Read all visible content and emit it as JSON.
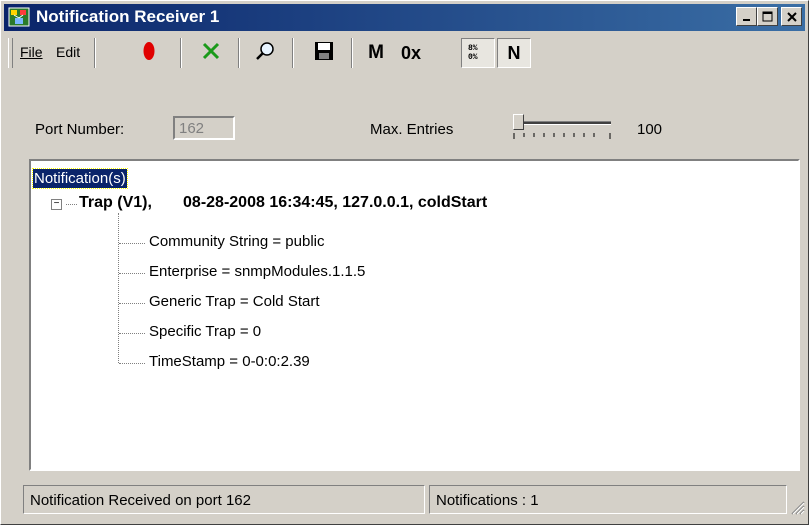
{
  "window": {
    "title": "Notification Receiver 1",
    "title_icon": "network-monitor-icon",
    "controls": {
      "minimize": "_",
      "maximize": "□",
      "close": "×"
    }
  },
  "menu": {
    "file": "File",
    "edit": "Edit"
  },
  "toolbar": {
    "record_icon": "record-icon",
    "delete_icon": "delete-icon",
    "find_icon": "find-icon",
    "save_icon": "save-icon",
    "m_label": "M",
    "hex_label": "0x",
    "n_label": "N"
  },
  "settings": {
    "port_label": "Port Number:",
    "port_value": "162",
    "max_entries_label": "Max. Entries",
    "max_entries_value": "100",
    "max_entries_slider_fraction": 0.0
  },
  "tree": {
    "root": "Notification(s)",
    "trap_header": "Trap (V1),       08-28-2008 16:34:45, 127.0.0.1, coldStart",
    "children": [
      "Community String = public",
      "Enterprise = snmpModules.1.1.5",
      "Generic Trap = Cold Start",
      "Specific Trap = 0",
      "TimeStamp = 0-0:0:2.39"
    ]
  },
  "status": {
    "left": "Notification Received on port 162",
    "right": "Notifications : 1"
  },
  "colors": {
    "titlebar_start": "#0a246a",
    "titlebar_end": "#3a6ea5",
    "record": "#e00000",
    "delete": "#1a9a1a",
    "selection": "#0a246a"
  }
}
